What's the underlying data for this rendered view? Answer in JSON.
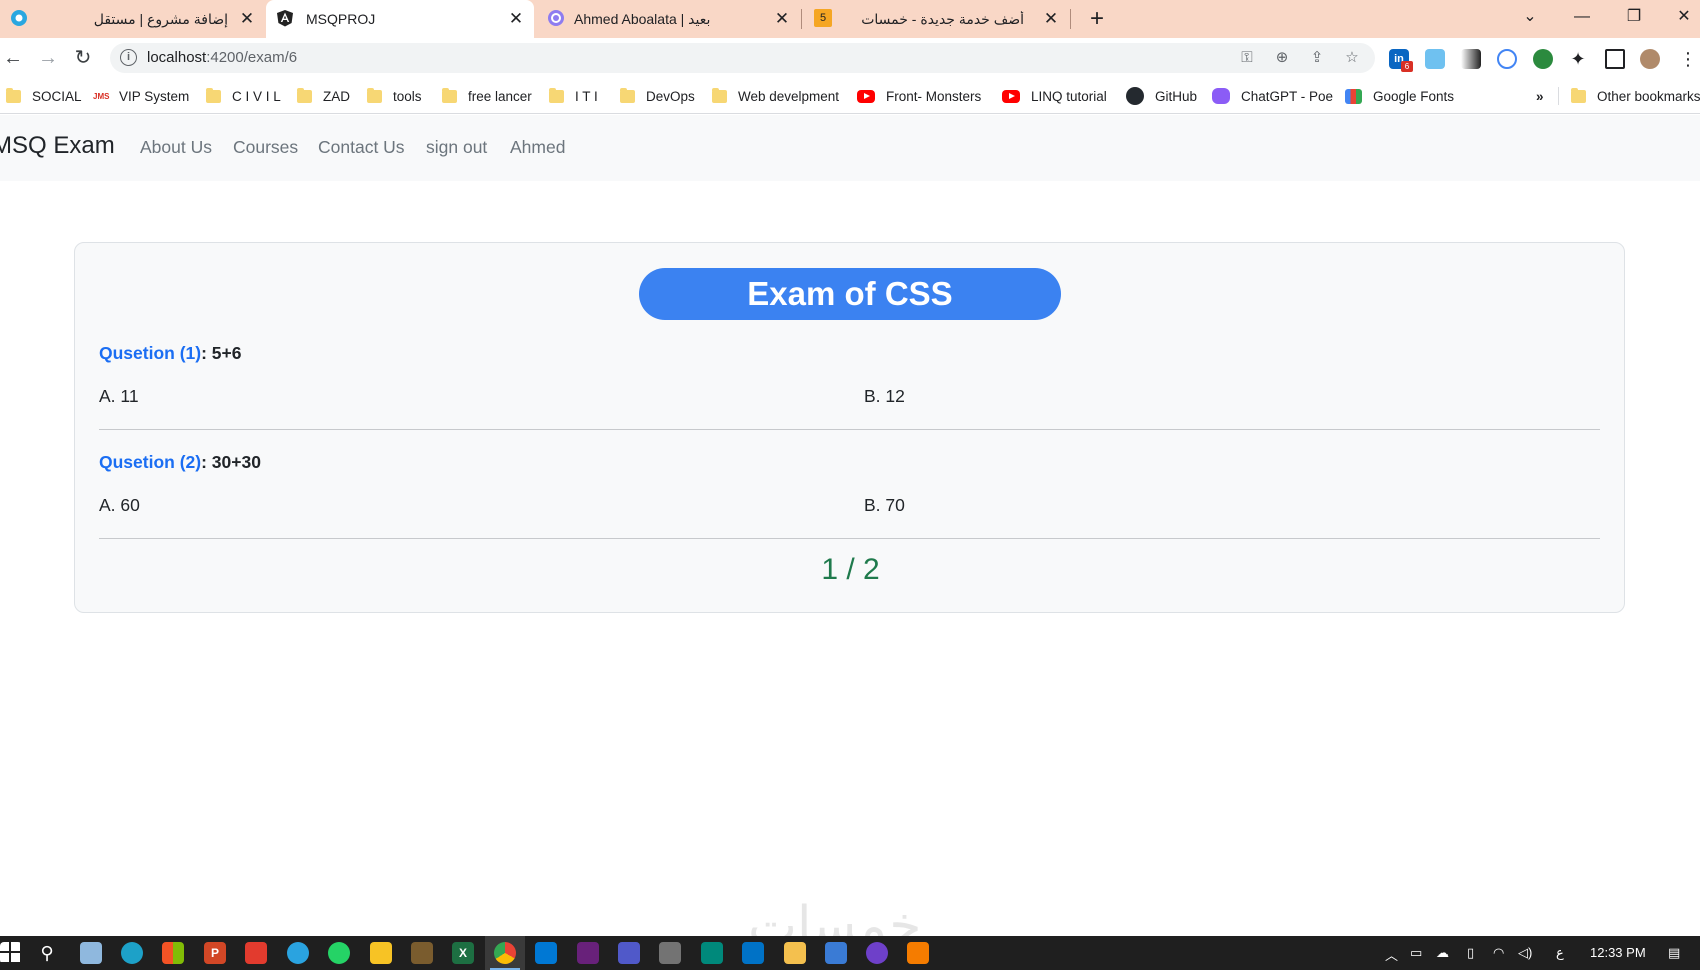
{
  "browser": {
    "tabs": [
      {
        "title": "إضافة مشروع | مستقل",
        "icon": "mostaql-icon",
        "active": false
      },
      {
        "title": "MSQPROJ",
        "icon": "angular-icon",
        "active": true
      },
      {
        "title": "Ahmed Aboalata | بعيد",
        "icon": "baaeed-icon",
        "active": false
      },
      {
        "title": "أضف خدمة جديدة - خمسات",
        "icon": "khamsat-icon",
        "badge": "5",
        "active": false
      }
    ],
    "new_tab_label": "+",
    "url_host": "localhost",
    "url_path": ":4200/exam/6",
    "bookmarks": [
      {
        "label": "SOCIAL",
        "icon": "folder-icon"
      },
      {
        "label": "VIP System",
        "icon": "jms-icon"
      },
      {
        "label": "C I V I L",
        "icon": "folder-icon"
      },
      {
        "label": "ZAD",
        "icon": "folder-icon"
      },
      {
        "label": "tools",
        "icon": "folder-icon"
      },
      {
        "label": "free lancer",
        "icon": "folder-icon"
      },
      {
        "label": "I T I",
        "icon": "folder-icon"
      },
      {
        "label": "DevOps",
        "icon": "folder-icon"
      },
      {
        "label": "Web develpment",
        "icon": "folder-icon"
      },
      {
        "label": "Front- Monsters",
        "icon": "youtube-icon"
      },
      {
        "label": "LINQ tutorial",
        "icon": "youtube-icon"
      },
      {
        "label": "GitHub",
        "icon": "github-icon"
      },
      {
        "label": "ChatGPT - Poe",
        "icon": "poe-icon"
      },
      {
        "label": "Google Fonts",
        "icon": "google-fonts-icon"
      }
    ],
    "bookmarks_overflow": "»",
    "other_bookmarks": "Other bookmarks",
    "extension_badge": "6"
  },
  "app": {
    "brand": "MSQ Exam",
    "nav": [
      "About Us",
      "Courses",
      "Contact Us",
      "sign out",
      "Ahmed"
    ]
  },
  "exam": {
    "title": "Exam of CSS",
    "questions": [
      {
        "label": "Qusetion (1)",
        "text": ": 5+6",
        "options": [
          "A. 11",
          "B. 12"
        ]
      },
      {
        "label": "Qusetion (2)",
        "text": ": 30+30",
        "options": [
          "A. 60",
          "B. 70"
        ]
      }
    ],
    "pager": "1 / 2"
  },
  "watermark": "خمسات",
  "taskbar": {
    "lang": "ع",
    "time": "12:33 PM"
  },
  "colors": {
    "tab_strip": "#f9d7c6",
    "title_pill": "#3b82f1",
    "question_label": "#1b6ef3",
    "pager": "#1f7a4c"
  }
}
